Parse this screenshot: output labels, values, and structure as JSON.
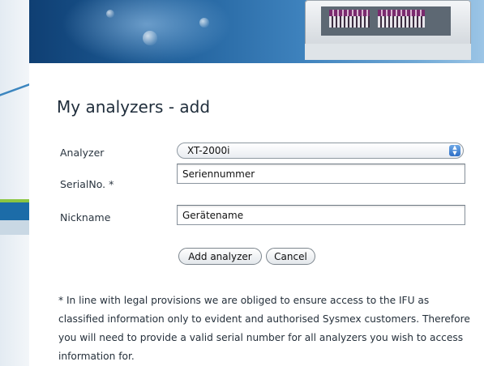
{
  "page": {
    "title": "My analyzers - add"
  },
  "form": {
    "analyzer": {
      "label": "Analyzer",
      "selected": "XT-2000i"
    },
    "serial": {
      "label": "SerialNo. *",
      "value": "Seriennummer"
    },
    "nickname": {
      "label": "Nickname",
      "value": "Gerätename"
    },
    "buttons": {
      "add": "Add analyzer",
      "cancel": "Cancel"
    }
  },
  "footnote": "* In line with legal provisions we are obliged to ensure access to the IFU as classified information only to evident and authorised Sysmex customers. Therefore you will need to provide a valid serial number for all analyzers you wish to access information for.",
  "colors": {
    "banner_dark": "#0f3f73",
    "banner_light": "#9cc5e6",
    "rail_blue": "#1c6ca8",
    "rail_green": "#8cc641",
    "select_arrow": "#2e6fc6"
  },
  "icons": {
    "select_arrow": "chevron-up-down-icon"
  }
}
